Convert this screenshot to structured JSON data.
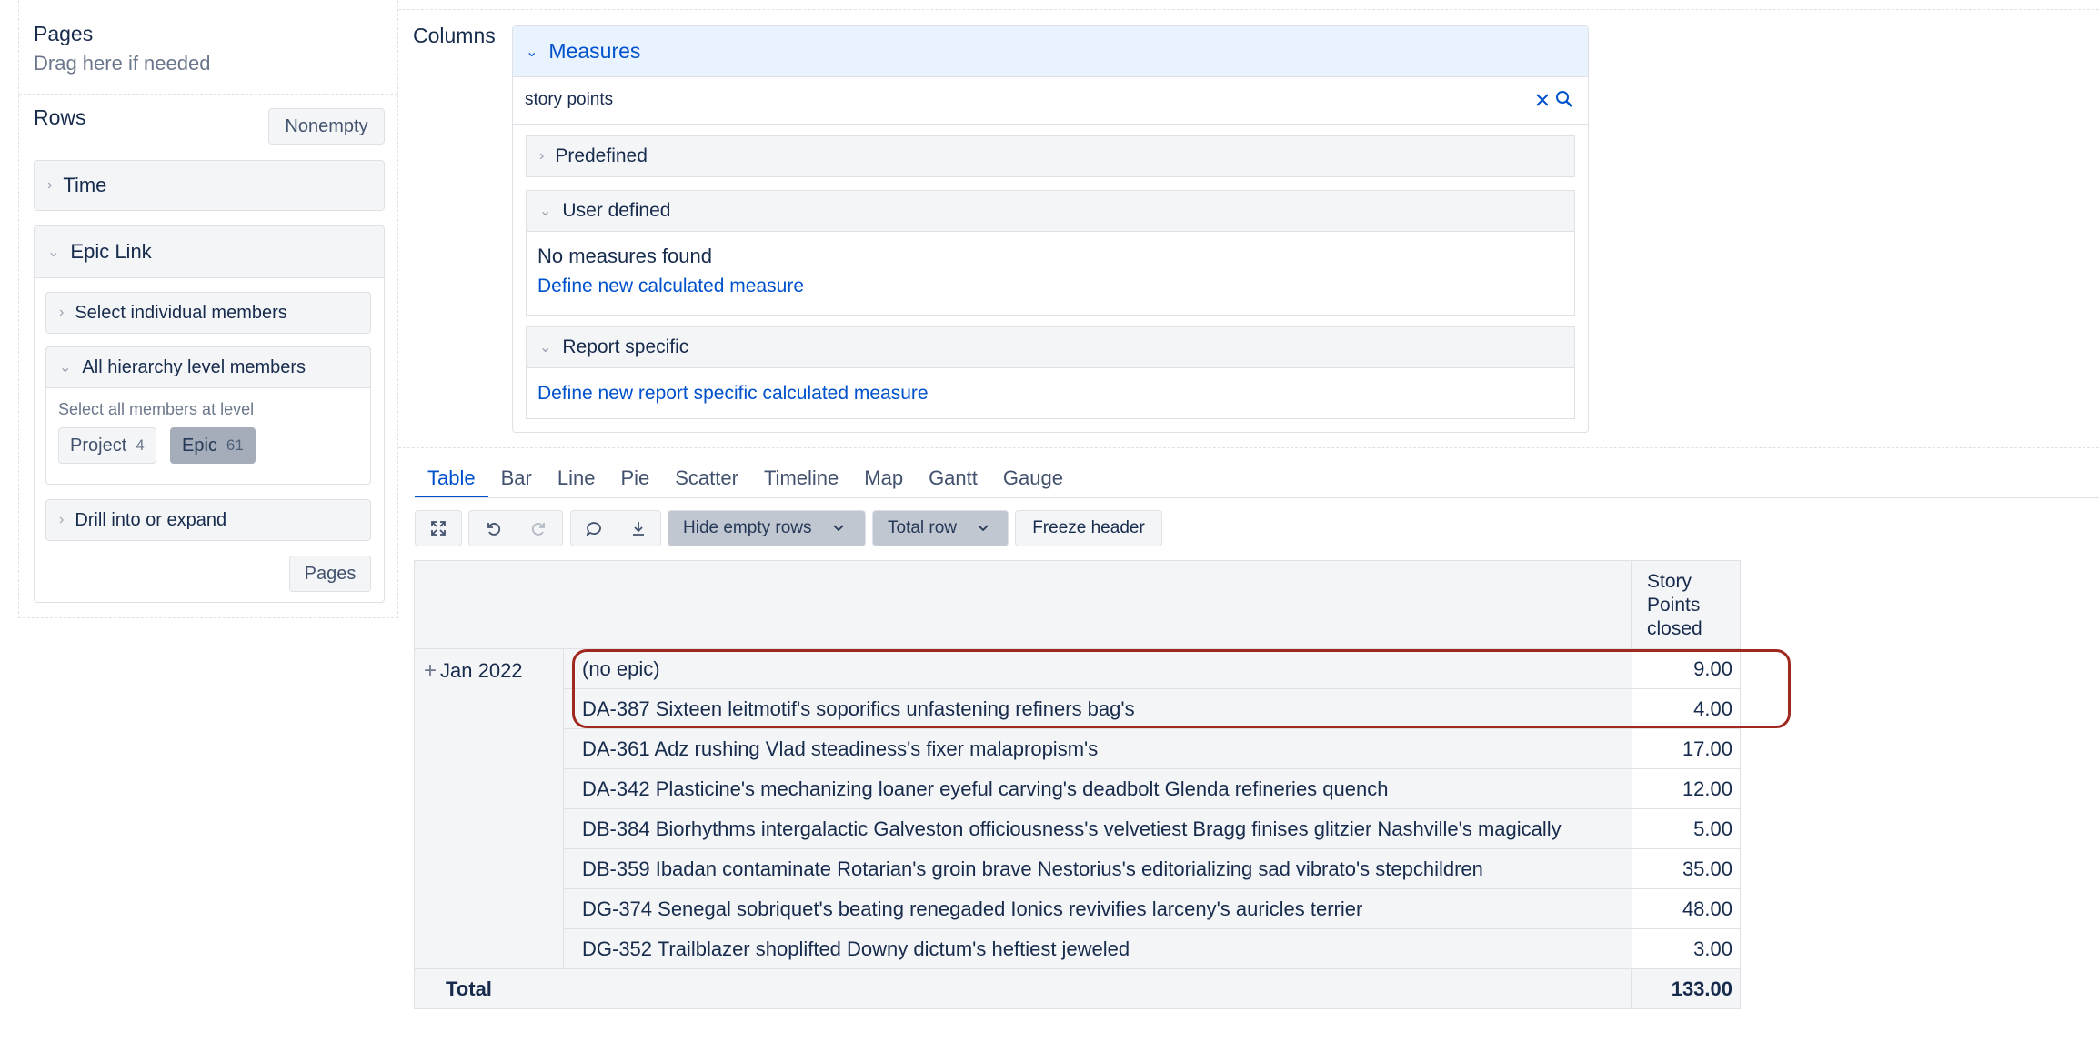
{
  "pages": {
    "title": "Pages",
    "hint": "Drag here if needed"
  },
  "rows": {
    "title": "Rows",
    "nonempty_label": "Nonempty",
    "time_label": "Time",
    "epic_link": {
      "label": "Epic Link",
      "select_individual_label": "Select individual members",
      "all_hierarchy_label": "All hierarchy level members",
      "select_all_hint": "Select all members at level",
      "levels": [
        {
          "label": "Project",
          "count": "4"
        },
        {
          "label": "Epic",
          "count": "61"
        }
      ],
      "drill_label": "Drill into or expand",
      "pages_button": "Pages"
    }
  },
  "columns": {
    "label": "Columns",
    "measures_title": "Measures",
    "search_value": "story points",
    "sections": {
      "predefined": "Predefined",
      "user_defined": "User defined",
      "no_measures": "No measures found",
      "define_calc": "Define new calculated measure",
      "report_specific": "Report specific",
      "define_report_calc": "Define new report specific calculated measure"
    }
  },
  "tabs": [
    "Table",
    "Bar",
    "Line",
    "Pie",
    "Scatter",
    "Timeline",
    "Map",
    "Gantt",
    "Gauge"
  ],
  "toolbar": {
    "hide_empty_rows": "Hide empty rows",
    "total_row": "Total row",
    "freeze_header": "Freeze header"
  },
  "table": {
    "column_header": "Story Points closed",
    "column_header_lines": [
      "Story",
      "Points",
      "closed"
    ],
    "row_group": "Jan 2022",
    "rows": [
      {
        "name": "(no epic)",
        "value": "9.00"
      },
      {
        "name": "DA-387 Sixteen leitmotif's soporifics unfastening refiners bag's",
        "value": "4.00"
      },
      {
        "name": "DA-361 Adz rushing Vlad steadiness's fixer malapropism's",
        "value": "17.00"
      },
      {
        "name": "DA-342 Plasticine's mechanizing loaner eyeful carving's deadbolt Glenda refineries quench",
        "value": "12.00"
      },
      {
        "name": "DB-384 Biorhythms intergalactic Galveston officiousness's velvetiest Bragg finises glitzier Nashville's magically",
        "value": "5.00"
      },
      {
        "name": "DB-359 Ibadan contaminate Rotarian's groin brave Nestorius's editorializing sad vibrato's stepchildren",
        "value": "35.00"
      },
      {
        "name": "DG-374 Senegal sobriquet's beating renegaded Ionics revivifies larceny's auricles terrier",
        "value": "48.00"
      },
      {
        "name": "DG-352 Trailblazer shoplifted Downy dictum's heftiest jeweled",
        "value": "3.00"
      }
    ],
    "total_label": "Total",
    "total_value": "133.00"
  },
  "colors": {
    "accent": "#0052cc",
    "highlight": "#a0291f",
    "header_bg": "#e9f2ff"
  }
}
